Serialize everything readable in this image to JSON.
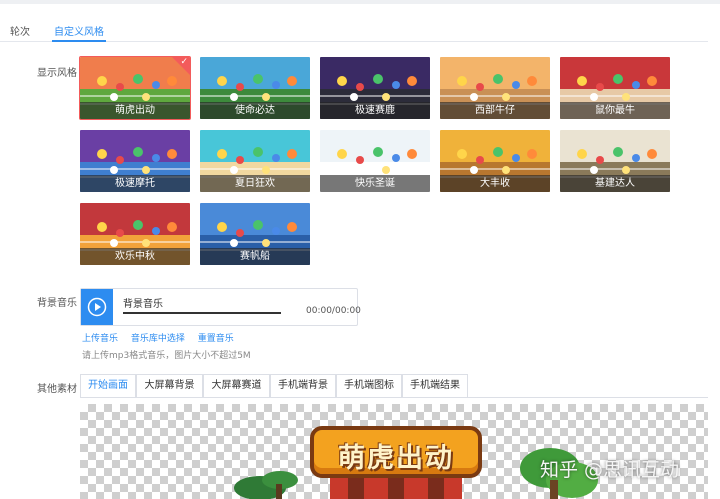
{
  "tabs": [
    {
      "label": "轮次",
      "active": false
    },
    {
      "label": "自定义风格",
      "active": true
    }
  ],
  "labels": {
    "display_style": "显示风格",
    "background_music": "背景音乐",
    "other_materials": "其他素材"
  },
  "themes": [
    {
      "name": "萌虎出动",
      "selected": true,
      "sky": "#f07d4c",
      "ground": "#5fa83e"
    },
    {
      "name": "使命必达",
      "selected": false,
      "sky": "#4aa7d8",
      "ground": "#3d8a3c"
    },
    {
      "name": "极速赛鹿",
      "selected": false,
      "sky": "#3a2a64",
      "ground": "#2c2c3a"
    },
    {
      "name": "西部牛仔",
      "selected": false,
      "sky": "#f3b46a",
      "ground": "#c99056"
    },
    {
      "name": "鼠你最牛",
      "selected": false,
      "sky": "#c9373a",
      "ground": "#e7c9a6"
    },
    {
      "name": "极速摩托",
      "selected": false,
      "sky": "#6a3fa4",
      "ground": "#3f7fd0"
    },
    {
      "name": "夏日狂欢",
      "selected": false,
      "sky": "#48c6d8",
      "ground": "#f1d8a0"
    },
    {
      "name": "快乐圣诞",
      "selected": false,
      "sky": "#eef4f8",
      "ground": "#ffffff"
    },
    {
      "name": "大丰收",
      "selected": false,
      "sky": "#f0b23a",
      "ground": "#b8772f"
    },
    {
      "name": "基建达人",
      "selected": false,
      "sky": "#eae3d2",
      "ground": "#8a7a5a"
    },
    {
      "name": "欢乐中秋",
      "selected": false,
      "sky": "#c2383c",
      "ground": "#f2a23a"
    },
    {
      "name": "赛帆船",
      "selected": false,
      "sky": "#4a8ad8",
      "ground": "#2a5fa8"
    }
  ],
  "music": {
    "title": "背景音乐",
    "time": "00:00/00:00",
    "links": [
      "上传音乐",
      "音乐库中选择",
      "重置音乐"
    ],
    "hint": "请上传mp3格式音乐，图片大小不超过5M"
  },
  "material_tabs": [
    {
      "label": "开始画面",
      "active": true
    },
    {
      "label": "大屏幕背景",
      "active": false
    },
    {
      "label": "大屏幕赛道",
      "active": false
    },
    {
      "label": "手机端背景",
      "active": false
    },
    {
      "label": "手机端图标",
      "active": false
    },
    {
      "label": "手机端结果",
      "active": false
    }
  ],
  "preview": {
    "logo_text": "萌虎出动"
  },
  "watermark": "知乎 @思讯互动",
  "colors": {
    "accent": "#2d8cf0",
    "selected": "#f35b5b"
  }
}
